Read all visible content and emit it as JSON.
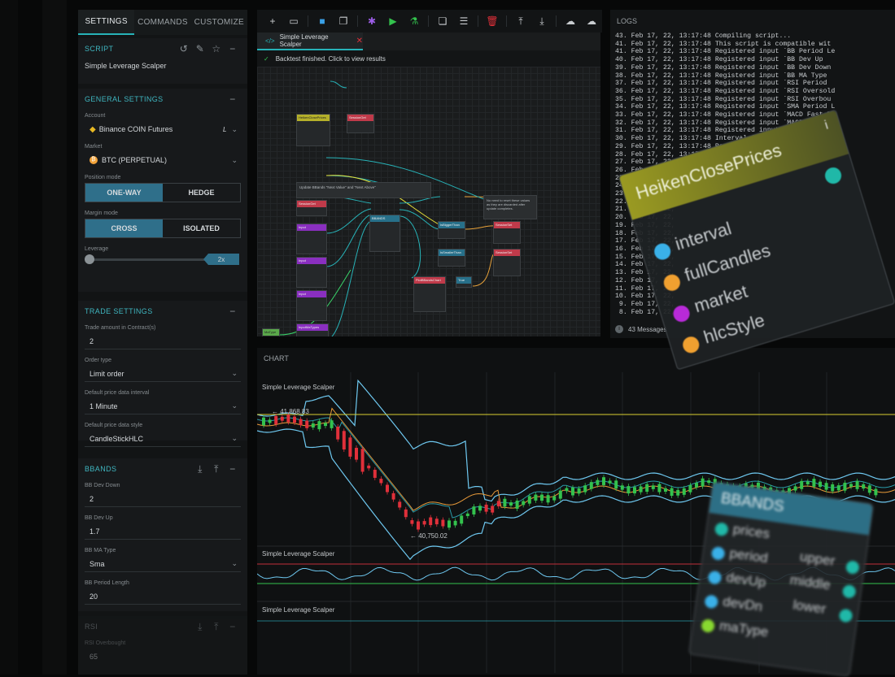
{
  "left": {
    "tabs": [
      "SETTINGS",
      "COMMANDS",
      "CUSTOMIZE"
    ],
    "script": {
      "title": "SCRIPT",
      "name": "Simple Leverage Scalper"
    },
    "general": {
      "title": "GENERAL SETTINGS",
      "account_label": "Account",
      "account_value": "Binance COIN Futures",
      "account_suffix": "L",
      "market_label": "Market",
      "market_value": "BTC (PERPETUAL)",
      "position_label": "Position mode",
      "position_options": [
        "ONE-WAY",
        "HEDGE"
      ],
      "margin_label": "Margin mode",
      "margin_options": [
        "CROSS",
        "ISOLATED"
      ],
      "leverage_label": "Leverage",
      "leverage_value": "2x"
    },
    "trade": {
      "title": "TRADE SETTINGS",
      "amount_label": "Trade amount in Contract(s)",
      "amount_value": "2",
      "order_label": "Order type",
      "order_value": "Limit order",
      "interval_label": "Default price data interval",
      "interval_value": "1 Minute",
      "style_label": "Default price data style",
      "style_value": "CandleStickHLC"
    },
    "bbands": {
      "title": "BBANDS",
      "fields": [
        {
          "label": "BB Dev Down",
          "value": "2"
        },
        {
          "label": "BB Dev Up",
          "value": "1.7"
        },
        {
          "label": "BB MA Type",
          "value": "Sma"
        },
        {
          "label": "BB Period Length",
          "value": "20"
        }
      ]
    },
    "rsi": {
      "title": "RSI",
      "field_label": "RSI Overbought",
      "field_value": "65"
    }
  },
  "editor": {
    "tab_label": "Simple Leverage Scalper",
    "banner": "Backtest finished. Click to view results",
    "note1": "Update BBands \"Next Value\" and \"Next Above\"",
    "note2": "No need to reset these values as they are discarded after update completes."
  },
  "logs": {
    "title": "LOGS",
    "lines": [
      "43. Feb 17, 22, 13:17:48 Compiling script...",
      "41. Feb 17, 22, 13:17:48 This script is compatible wit",
      "41. Feb 17, 22, 13:17:48 Registered input `BB Period Le",
      "40. Feb 17, 22, 13:17:48 Registered input `BB Dev Up",
      "39. Feb 17, 22, 13:17:48 Registered input `BB Dev Down",
      "38. Feb 17, 22, 13:17:48 Registered input `BB MA Type",
      "37. Feb 17, 22, 13:17:48 Registered input `RSI Period",
      "36. Feb 17, 22, 13:17:48 Registered input `RSI Oversold",
      "35. Feb 17, 22, 13:17:48 Registered input `RSI Overbou",
      "34. Feb 17, 22, 13:17:48 Registered input `SMA Period L",
      "33. Feb 17, 22, 13:17:48 Registered input `MACD Fast Pe",
      "32. Feb 17, 22, 13:17:48 Registered input `MACD Slow Pe",
      "31. Feb 17, 22, 13:17:48 Registered input `MACD Signal",
      "30. Feb 17, 22, 13:17:48 Interval input field interval",
      "29. Feb 17, 22, 13:17:48 Registered input `MA1 - activ",
      "28. Feb 17, 22, 13:17:48 Registered input `ma...",
      "27. Feb 17, 22, 13:17:48 Registered input",
      "26. Feb 17, 22, 13:17:48",
      "25. Feb 17, 22, 13:17:48",
      "24. Feb 17, 22,",
      "23. Feb 17, 22,",
      "22. Feb 17, 22,",
      "21. Feb 17, 22,",
      "20. Feb 17, 22,",
      "19. Feb 17, 22,",
      "18. Feb 17, 22,",
      "17. Feb 17, 22,",
      "16. Feb 17, 22,",
      "15. Feb 17, 22,",
      "14. Feb 17, 22,",
      "13. Feb 17, 22,",
      "12. Feb 17, 22,",
      "11. Feb 17, 22,",
      "10. Feb 17, 22,",
      " 9. Feb 17, 22,",
      " 8. Feb 17, 22,"
    ],
    "count": "43 Messages"
  },
  "chart": {
    "title": "CHART",
    "panel1": "Simple Leverage Scalper",
    "panel2": "Simple Leverage Scalper",
    "panel3": "Simple Leverage Scalper",
    "high_label": "41,868.83",
    "low_label": "40,750.02"
  },
  "card_heiken": {
    "title": "HeikenClosePrices",
    "inputs": [
      "interval",
      "fullCandles",
      "market",
      "hlcStyle"
    ]
  },
  "card_bbands": {
    "title": "BBANDS",
    "inputs": [
      "prices",
      "period",
      "devUp",
      "devDn",
      "maType"
    ],
    "outputs": [
      "upper",
      "middle",
      "lower"
    ]
  }
}
